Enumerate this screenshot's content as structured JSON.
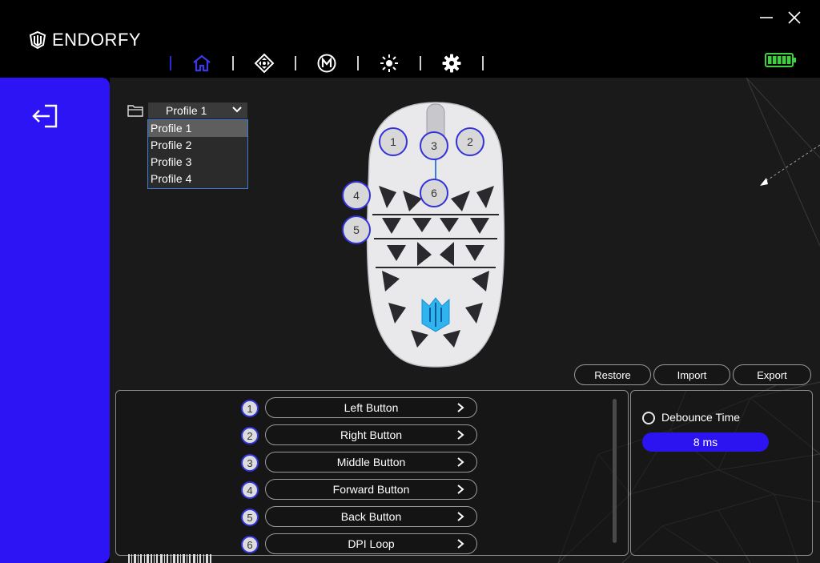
{
  "app": {
    "brand": "ENDORFY"
  },
  "nav": {
    "items": [
      "home-icon",
      "move-icon",
      "macro-icon",
      "lighting-icon",
      "settings-icon"
    ]
  },
  "profile": {
    "selected": "Profile 1",
    "options": [
      "Profile 1",
      "Profile 2",
      "Profile 3",
      "Profile 4"
    ]
  },
  "hotspots": [
    "1",
    "2",
    "3",
    "4",
    "5",
    "6"
  ],
  "actions": {
    "restore": "Restore",
    "import": "Import",
    "export": "Export"
  },
  "buttons": [
    {
      "num": "1",
      "label": "Left Button"
    },
    {
      "num": "2",
      "label": "Right Button"
    },
    {
      "num": "3",
      "label": "Middle Button"
    },
    {
      "num": "4",
      "label": "Forward Button"
    },
    {
      "num": "5",
      "label": "Back Button"
    },
    {
      "num": "6",
      "label": "DPI Loop"
    }
  ],
  "debounce": {
    "label": "Debounce Time",
    "value": "8 ms"
  },
  "colors": {
    "accent": "#2d14f4",
    "battery": "#3cd23c",
    "logo_glow": "#2fb4f0"
  },
  "battery": {
    "level": 1.0
  }
}
